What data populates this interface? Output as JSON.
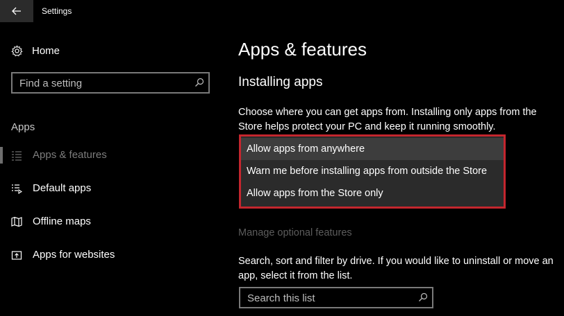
{
  "window": {
    "title": "Settings"
  },
  "sidebar": {
    "home_label": "Home",
    "search_placeholder": "Find a setting",
    "section_label": "Apps",
    "items": [
      {
        "label": "Apps & features",
        "icon": "list-icon"
      },
      {
        "label": "Default apps",
        "icon": "default-apps-icon"
      },
      {
        "label": "Offline maps",
        "icon": "map-icon"
      },
      {
        "label": "Apps for websites",
        "icon": "open-in-window-icon"
      }
    ]
  },
  "main": {
    "title": "Apps & features",
    "subtitle": "Installing apps",
    "description": "Choose where you can get apps from. Installing only apps from the Store helps protect your PC and keep it running smoothly.",
    "dropdown_options": [
      "Allow apps from anywhere",
      "Warn me before installing apps from outside the Store",
      "Allow apps from the Store only"
    ],
    "manage_link": "Manage optional features",
    "search_description": "Search, sort and filter by drive. If you would like to uninstall or move an app, select it from the list.",
    "search_placeholder": "Search this list"
  },
  "colors": {
    "background": "#000000",
    "dropdown_bg": "#2b2b2b",
    "highlight_border": "#c4262e",
    "muted_text": "#5c5c5c"
  }
}
